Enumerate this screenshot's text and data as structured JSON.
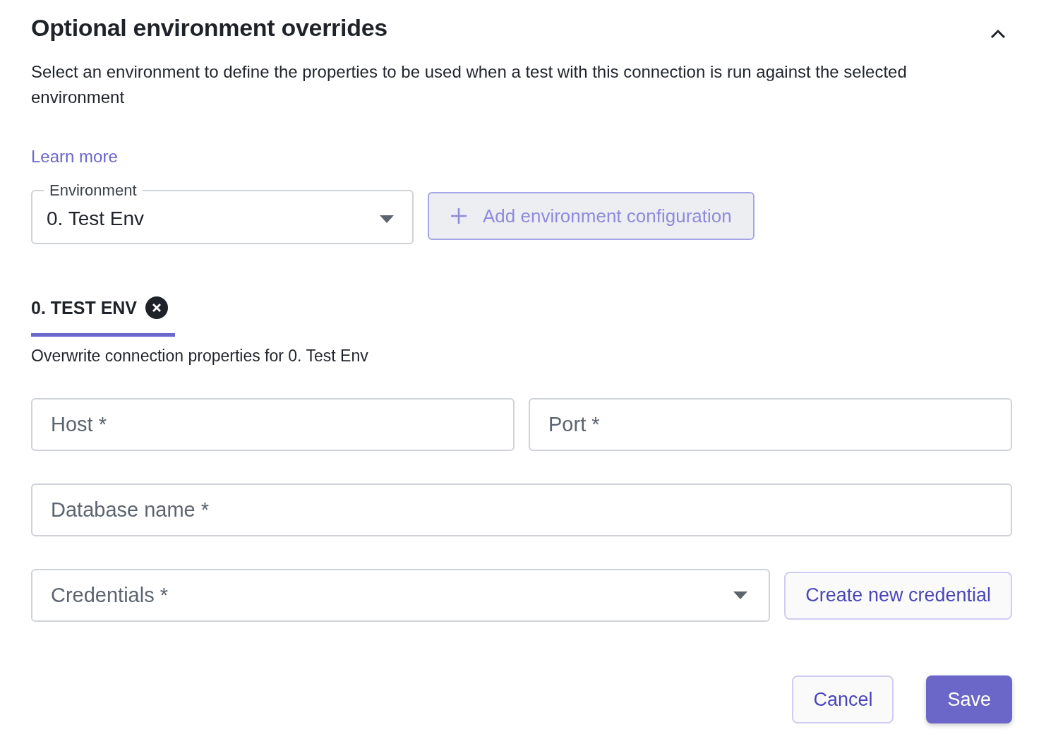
{
  "section": {
    "title": "Optional environment overrides",
    "expanded": true,
    "description": "Select an environment to define the properties to be used when a test with this connection is run against the selected environment",
    "link": "Learn more"
  },
  "environment_select": {
    "label": "Environment",
    "value": "0. Test Env"
  },
  "add_button": {
    "label": "Add environment configuration",
    "disabled": true
  },
  "tabs": [
    {
      "label": "0. TEST ENV",
      "selected": true
    }
  ],
  "tab_description": "Overwrite connection properties for 0. Test Env",
  "field_rows": [
    [
      {
        "kind": "input",
        "placeholder": "Host *"
      },
      {
        "kind": "input",
        "placeholder": "Port *"
      }
    ],
    [
      {
        "kind": "input",
        "placeholder": "Database name *"
      }
    ],
    [
      {
        "kind": "select",
        "placeholder": "Credentials *"
      },
      {
        "kind": "button",
        "label": "Create new credential"
      }
    ]
  ],
  "actions": [
    {
      "label": "Cancel",
      "kind": "secondary"
    },
    {
      "label": "Save",
      "kind": "primary"
    }
  ]
}
